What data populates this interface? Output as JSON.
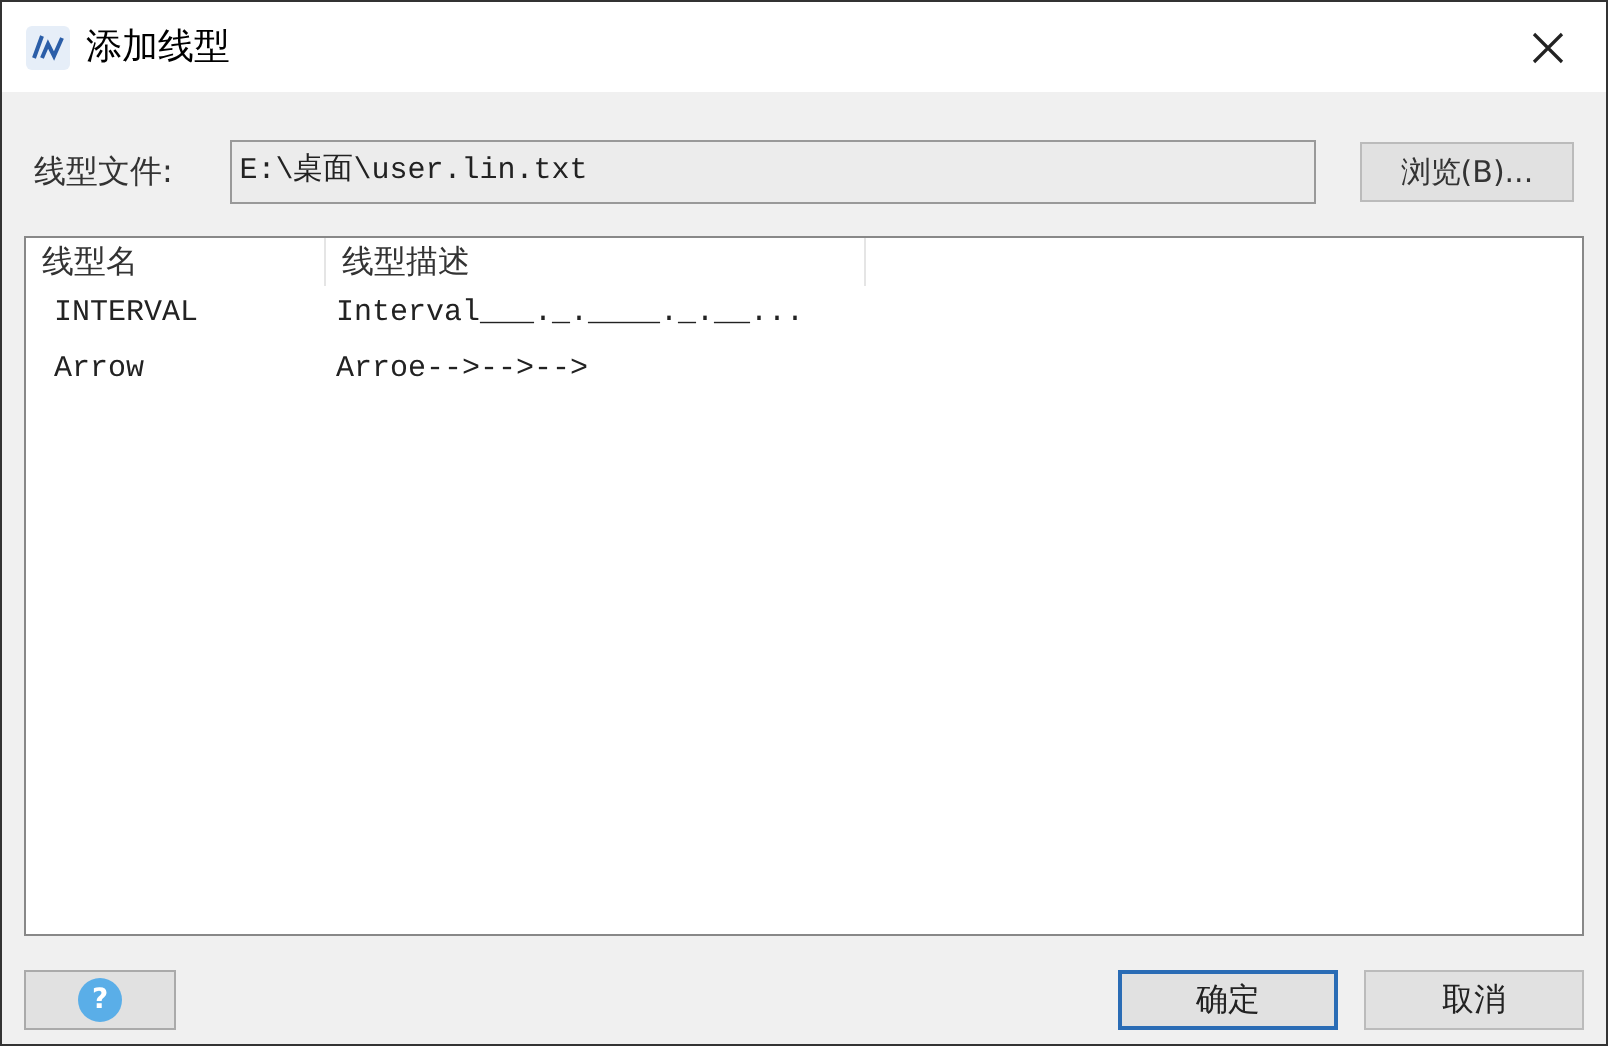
{
  "window": {
    "title": "添加线型"
  },
  "file": {
    "label": "线型文件:",
    "value": "E:\\桌面\\user.lin.txt",
    "browse_button": "浏览(B)..."
  },
  "table": {
    "columns": [
      "线型名",
      "线型描述"
    ],
    "rows": [
      {
        "name": "INTERVAL",
        "description": "Interval___._.____._.__...",
        "selected": false
      },
      {
        "name": "Arrow",
        "description": "Arroe-->-->-->",
        "selected": false
      }
    ]
  },
  "buttons": {
    "help": "?",
    "ok": "确定",
    "cancel": "取消"
  }
}
